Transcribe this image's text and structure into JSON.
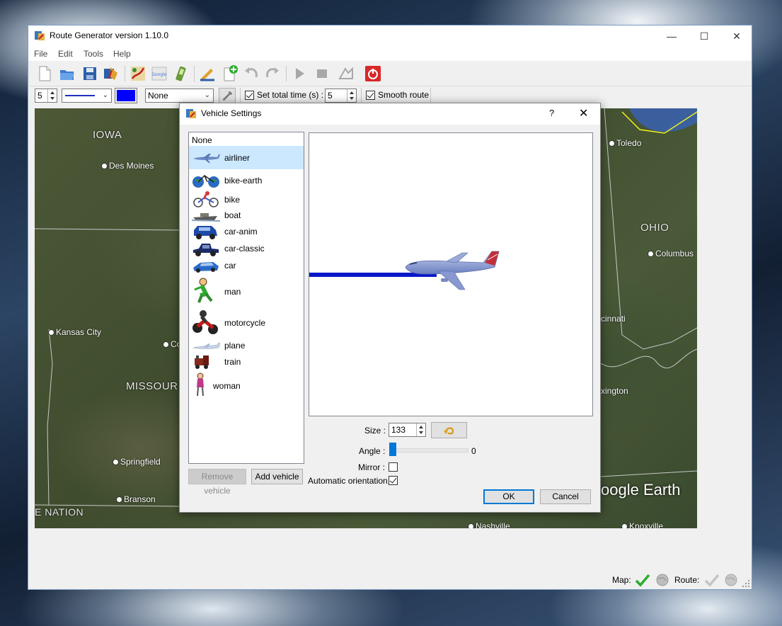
{
  "app": {
    "title": "Route Generator version 1.10.0",
    "menu": [
      "File",
      "Edit",
      "Tools",
      "Help"
    ],
    "toolbar2": {
      "line_width": "5",
      "vehicle_combo": "None",
      "set_total_time_label": "Set total time (s) :",
      "total_time_value": "5",
      "set_total_time_checked": true,
      "smooth_route_label": "Smooth route",
      "smooth_route_checked": true,
      "route_color": "#0000ff"
    },
    "map": {
      "states": [
        "IOWA",
        "MISSOUR",
        "OHIO",
        "E NATION"
      ],
      "cities": [
        "Des Moines",
        "Kansas City",
        "Co",
        "Springfield",
        "Branson",
        "Toledo",
        "Columbus",
        "cinnati",
        "xington",
        "Nashville",
        "Knoxville"
      ],
      "watermark": "oogle Earth"
    },
    "status": {
      "map_label": "Map:",
      "route_label": "Route:"
    }
  },
  "dialog": {
    "title": "Vehicle Settings",
    "help": "?",
    "vehicles": [
      "None",
      "airliner",
      "bike-earth",
      "bike",
      "boat",
      "car-anim",
      "car-classic",
      "car",
      "man",
      "motorcycle",
      "plane",
      "train",
      "woman"
    ],
    "selected": "airliner",
    "remove_label": "Remove vehicle",
    "add_label": "Add vehicle",
    "size_label": "Size :",
    "size_value": "133",
    "angle_label": "Angle :",
    "angle_value": "0",
    "mirror_label": "Mirror :",
    "mirror_checked": false,
    "auto_orient_label": "Automatic orientation:",
    "auto_orient_checked": true,
    "ok_label": "OK",
    "cancel_label": "Cancel"
  }
}
